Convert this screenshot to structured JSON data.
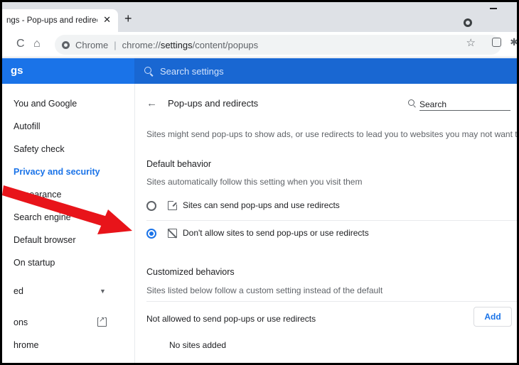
{
  "browser": {
    "tab_title": "ngs - Pop-ups and redirects",
    "tab_close": "✕",
    "new_tab": "+",
    "back": "←",
    "reload": "C",
    "home": "⌂",
    "site_label": "Chrome",
    "separator": "|",
    "url_scheme": "chrome://",
    "url_bold": "settings",
    "url_rest": "/content/popups",
    "star": "☆",
    "extension": "✱"
  },
  "header": {
    "title": "gs",
    "search_placeholder": "Search settings"
  },
  "sidebar": {
    "items": [
      {
        "label": "You and Google"
      },
      {
        "label": "Autofill"
      },
      {
        "label": "Safety check"
      },
      {
        "label": "Privacy and security",
        "active": true
      },
      {
        "label": "Appearance"
      },
      {
        "label": "Search engine"
      },
      {
        "label": "Default browser"
      },
      {
        "label": "On startup"
      },
      {
        "label": "ed"
      },
      {
        "label": "ons"
      },
      {
        "label": "hrome"
      }
    ],
    "chevron": "▼"
  },
  "page": {
    "back_arrow": "←",
    "title": "Pop-ups and redirects",
    "search_placeholder": "Search",
    "description": "Sites might send pop-ups to show ads, or use redirects to lead you to websites you may not want to visit",
    "default_behavior": {
      "heading": "Default behavior",
      "subtext": "Sites automatically follow this setting when you visit them",
      "options": [
        {
          "label": "Sites can send pop-ups and use redirects",
          "selected": false
        },
        {
          "label": "Don't allow sites to send pop-ups or use redirects",
          "selected": true
        }
      ]
    },
    "customized": {
      "heading": "Customized behaviors",
      "subtext": "Sites listed below follow a custom setting instead of the default",
      "list_label": "Not allowed to send pop-ups or use redirects",
      "add_label": "Add",
      "empty_text": "No sites added"
    }
  },
  "colors": {
    "accent": "#1a73e8",
    "arrow": "#e8141a"
  }
}
